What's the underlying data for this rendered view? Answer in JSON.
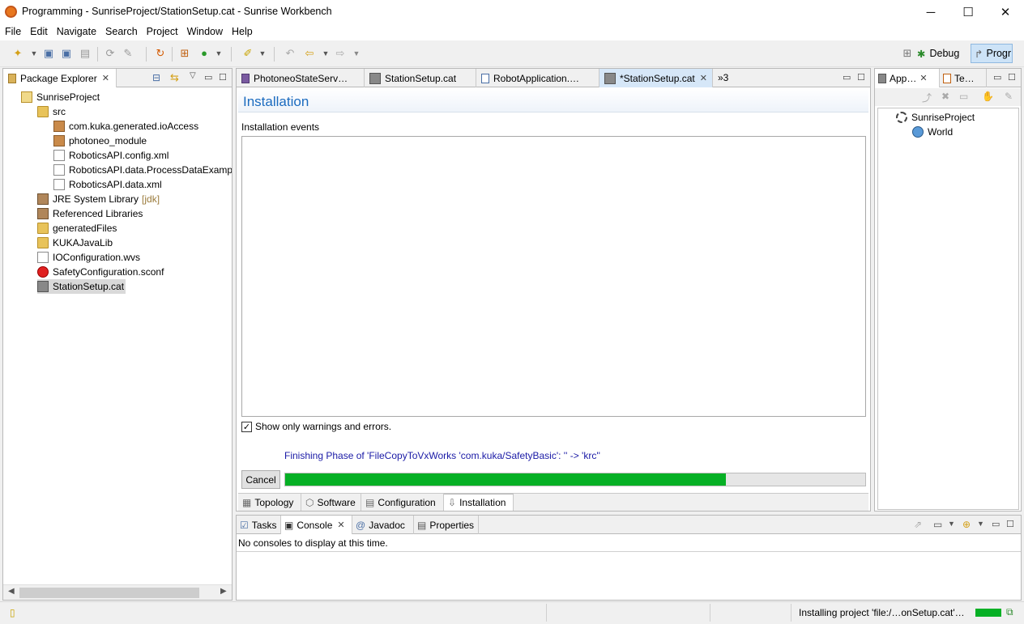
{
  "window": {
    "title": "Programming - SunriseProject/StationSetup.cat - Sunrise Workbench",
    "minimize": "─",
    "maximize": "☐",
    "close": "✕"
  },
  "menu": [
    "File",
    "Edit",
    "Navigate",
    "Search",
    "Project",
    "Window",
    "Help"
  ],
  "perspectives": {
    "debug": "Debug",
    "programming": "Progr"
  },
  "package_explorer": {
    "tab_label": "Package Explorer",
    "items": [
      {
        "label": "SunriseProject",
        "icon": "project-icon"
      },
      {
        "label": "src",
        "icon": "source-folder-icon"
      },
      {
        "label": "com.kuka.generated.ioAccess",
        "icon": "package-icon"
      },
      {
        "label": "photoneo_module",
        "icon": "package-icon"
      },
      {
        "label": "RoboticsAPI.config.xml",
        "icon": "file-icon"
      },
      {
        "label": "RoboticsAPI.data.ProcessDataExample",
        "icon": "file-icon"
      },
      {
        "label": "RoboticsAPI.data.xml",
        "icon": "file-icon"
      },
      {
        "label": "JRE System Library",
        "suffix": "[jdk]",
        "icon": "library-icon"
      },
      {
        "label": "Referenced Libraries",
        "icon": "library-icon"
      },
      {
        "label": "generatedFiles",
        "icon": "folder-icon"
      },
      {
        "label": "KUKAJavaLib",
        "icon": "folder-icon"
      },
      {
        "label": "IOConfiguration.wvs",
        "icon": "file-icon"
      },
      {
        "label": "SafetyConfiguration.sconf",
        "icon": "safety-icon"
      },
      {
        "label": "StationSetup.cat",
        "icon": "station-icon"
      }
    ]
  },
  "editor_tabs": {
    "tabs": [
      {
        "label": "PhotoneoStateServ…"
      },
      {
        "label": "StationSetup.cat"
      },
      {
        "label": "RobotApplication.…"
      },
      {
        "label": "*StationSetup.cat"
      }
    ],
    "overflow": "»3"
  },
  "installation": {
    "heading": "Installation",
    "events_label": "Installation events",
    "checkbox_label": "Show only warnings and errors.",
    "checkbox_checked": true,
    "phase_text": "Finishing Phase of 'FileCopyToVxWorks 'com.kuka/SafetyBasic': '' -> 'krc''",
    "cancel_label": "Cancel",
    "progress": 0.76
  },
  "station_tabs": [
    "Topology",
    "Software",
    "Configuration",
    "Installation"
  ],
  "app_view": {
    "tab1": "App…",
    "tab2": "Te…",
    "tree": [
      {
        "label": "SunriseProject"
      },
      {
        "label": "World"
      }
    ]
  },
  "console": {
    "tabs": [
      "Tasks",
      "Console",
      "Javadoc",
      "Properties"
    ],
    "message": "No consoles to display at this time."
  },
  "status": {
    "text": "Installing project 'file:/…onSetup.cat'…"
  },
  "colors": {
    "accent": "#1b6bbf",
    "progress": "#06b025",
    "phase_text": "#1a1aa6"
  }
}
